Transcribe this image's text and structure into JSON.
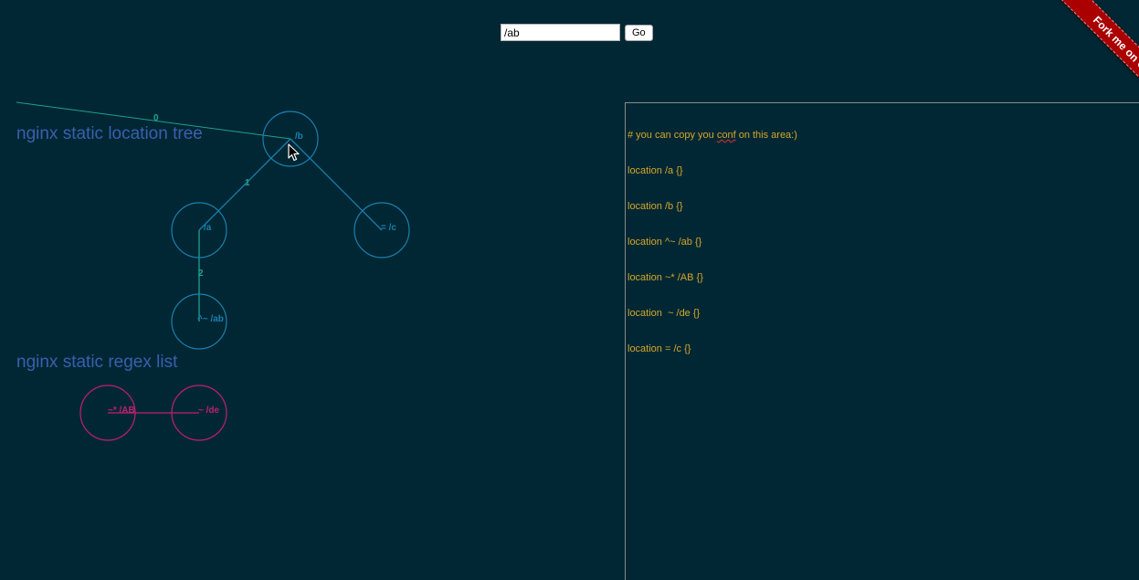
{
  "search": {
    "value": "/ab",
    "button_label": "Go"
  },
  "ribbon": {
    "label": "Fork me on GitHub",
    "color": "#aa0000"
  },
  "headings": {
    "tree": "nginx static location tree",
    "regex": "nginx static regex list"
  },
  "tree": {
    "nodes": {
      "root": "/b",
      "left": "/a",
      "right": "= /c",
      "leaf": "^~ /ab"
    },
    "edges": {
      "root_edge": "0",
      "left_edge": "1",
      "leaf_edge": "2"
    },
    "color": "#1a7fb0",
    "edge_label_color": "#1fa090"
  },
  "regex": {
    "nodes": {
      "first": "~* /AB",
      "second": "~ /de"
    },
    "color": "#c02070"
  },
  "conf": {
    "comment_pre": "# you can copy you ",
    "comment_misspelled": "conf",
    "comment_post": " on this area:)",
    "lines": [
      "location /a {}",
      "location /b {}",
      "location ^~ /ab {}",
      "location ~* /AB {}",
      "location  ~ /de {}",
      "location = /c {}"
    ],
    "text_color": "#d5a72a"
  },
  "colors": {
    "background": "#002733",
    "heading": "#3a5fb0"
  }
}
